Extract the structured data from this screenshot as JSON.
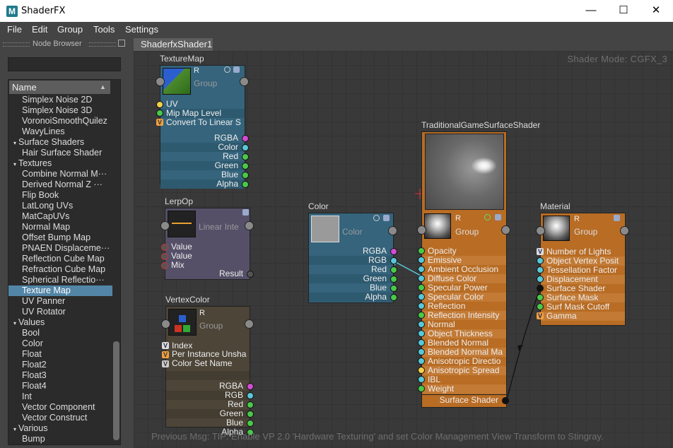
{
  "window": {
    "title": "ShaderFX",
    "app_icon": "M",
    "minimize": "—",
    "maximize": "☐",
    "close": "✕"
  },
  "menu": [
    "File",
    "Edit",
    "Group",
    "Tools",
    "Settings"
  ],
  "node_browser": {
    "title": "Node Browser",
    "search_value": "",
    "column_header": "Name",
    "items": [
      {
        "label": "Simplex Noise 2D",
        "level": 1
      },
      {
        "label": "Simplex Noise 3D",
        "level": 1
      },
      {
        "label": "VoronoiSmoothQuilez",
        "level": 1
      },
      {
        "label": "WavyLines",
        "level": 1
      },
      {
        "label": "Surface Shaders",
        "level": 0,
        "expander": "▾"
      },
      {
        "label": "Hair Surface Shader",
        "level": 1
      },
      {
        "label": "Textures",
        "level": 0,
        "expander": "▾"
      },
      {
        "label": "Combine Normal M···",
        "level": 1
      },
      {
        "label": "Derived Normal Z ···",
        "level": 1
      },
      {
        "label": "Flip Book",
        "level": 1
      },
      {
        "label": "LatLong UVs",
        "level": 1
      },
      {
        "label": "MatCapUVs",
        "level": 1
      },
      {
        "label": "Normal Map",
        "level": 1
      },
      {
        "label": "Offset Bump Map",
        "level": 1
      },
      {
        "label": "PNAEN Displaceme···",
        "level": 1
      },
      {
        "label": "Reflection Cube Map",
        "level": 1
      },
      {
        "label": "Refraction Cube Map",
        "level": 1
      },
      {
        "label": "Spherical Reflectio···",
        "level": 1
      },
      {
        "label": "Texture Map",
        "level": 1,
        "selected": true
      },
      {
        "label": "UV Panner",
        "level": 1
      },
      {
        "label": "UV Rotator",
        "level": 1
      },
      {
        "label": "Values",
        "level": 0,
        "expander": "▾"
      },
      {
        "label": "Bool",
        "level": 1
      },
      {
        "label": "Color",
        "level": 1
      },
      {
        "label": "Float",
        "level": 1
      },
      {
        "label": "Float2",
        "level": 1
      },
      {
        "label": "Float3",
        "level": 1
      },
      {
        "label": "Float4",
        "level": 1
      },
      {
        "label": "Int",
        "level": 1
      },
      {
        "label": "Vector Component",
        "level": 1
      },
      {
        "label": "Vector Construct",
        "level": 1
      },
      {
        "label": "Various",
        "level": 0,
        "expander": "▾"
      },
      {
        "label": "Bump",
        "level": 1
      }
    ]
  },
  "tab": "ShaderfxShader1",
  "canvas": {
    "shader_mode": "Shader Mode: CGFX_3",
    "previous_msg": "Previous Msg: TIP: Enable VP 2.0 'Hardware Texturing' and set Color Management View Transform to Stingray."
  },
  "nodes": {
    "texturemap": {
      "title": "TextureMap",
      "r": "R",
      "group": "Group",
      "inputs": [
        "UV",
        "Mip Map Level",
        "Convert To Linear S"
      ],
      "outputs": [
        "RGBA",
        "Color",
        "Red",
        "Green",
        "Blue",
        "Alpha"
      ]
    },
    "lerpop": {
      "title": "LerpOp",
      "subtitle": "Linear Inte",
      "inputs": [
        "Value",
        "Value",
        "Mix"
      ],
      "outputs": [
        "Result"
      ]
    },
    "vertexcolor": {
      "title": "VertexColor",
      "r": "R",
      "group": "Group",
      "inputs": [
        "Index",
        "Per Instance Unsha",
        "Color Set Name"
      ],
      "outputs": [
        "RGBA",
        "RGB",
        "Red",
        "Green",
        "Blue",
        "Alpha"
      ]
    },
    "color": {
      "title": "Color",
      "subtitle": "Color",
      "outputs": [
        "RGBA",
        "RGB",
        "Red",
        "Green",
        "Blue",
        "Alpha"
      ]
    },
    "tgss": {
      "title": "TraditionalGameSurfaceShader",
      "r": "R",
      "group": "Group",
      "inputs": [
        "Opacity",
        "Emissive",
        "Ambient Occlusion",
        "Diffuse Color",
        "Specular Power",
        "Specular Color",
        "Reflection",
        "Reflection Intensity",
        "Normal",
        "Object Thickness",
        "Blended Normal",
        "Blended Normal Ma",
        "Anisotropic Directio",
        "Anisotropic Spread",
        "IBL",
        "Weight"
      ],
      "output": "Surface Shader"
    },
    "material": {
      "title": "Material",
      "r": "R",
      "group": "Group",
      "inputs": [
        "Number of Lights",
        "Object Vertex Posit",
        "Tessellation Factor",
        "Displacement",
        "Surface Shader",
        "Surface Mask",
        "Surf Mask Cutoff",
        "Gamma"
      ]
    }
  },
  "colors": {
    "texture_node": "#35647c",
    "lerp_node": "#555068",
    "vertex_node": "#4c4538",
    "color_node": "#35647c",
    "shader_node": "#b86c24",
    "selected_row": "#5285a6"
  }
}
